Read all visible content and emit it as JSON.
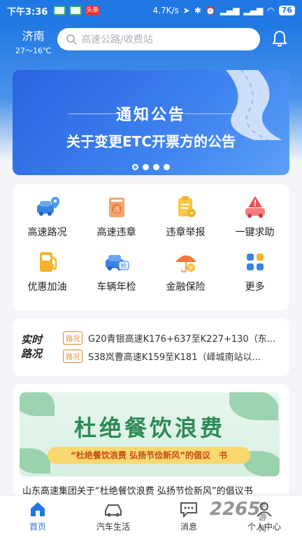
{
  "status_bar": {
    "time": "下午3:36",
    "app_badge": "头条",
    "net_speed": "4.7K/s",
    "battery": "76"
  },
  "header": {
    "city": "济南",
    "temp": "27～16℃",
    "search_placeholder": "高速公路/收费站"
  },
  "banner": {
    "title": "通知公告",
    "subtitle": "关于变更ETC开票方的公告",
    "dots": 4,
    "active_dot": 0
  },
  "services": [
    {
      "label": "高速路况",
      "icon": "car-location-icon",
      "color": "#3b82e6"
    },
    {
      "label": "高速违章",
      "icon": "violation-doc-icon",
      "color": "#f07a3a"
    },
    {
      "label": "违章举报",
      "icon": "report-doc-icon",
      "color": "#f3b32c"
    },
    {
      "label": "一键求助",
      "icon": "warning-car-icon",
      "color": "#ef4f4f"
    },
    {
      "label": "优惠加油",
      "icon": "fuel-pump-icon",
      "color": "#f3b32c"
    },
    {
      "label": "车辆年检",
      "icon": "car-inspection-icon",
      "color": "#3b82e6"
    },
    {
      "label": "金融保险",
      "icon": "umbrella-icon",
      "color": "#f07a3a"
    },
    {
      "label": "更多",
      "icon": "more-grid-icon",
      "color": "#3b82e6"
    }
  ],
  "traffic": {
    "title": "实时路况",
    "items": [
      {
        "tag": "路况",
        "text": "G20青银高速K176+637至K227+130（东..."
      },
      {
        "tag": "路况",
        "text": "S38岚曹高速K159至K181（峄城南站以..."
      }
    ]
  },
  "news": {
    "headline": "杜绝餐饮浪费",
    "pill": "“杜绝餐饮浪费 弘扬节俭新风”的倡议　书",
    "caption": "山东高速集团关于“杜绝餐饮浪费 弘扬节俭新风”的倡议书"
  },
  "tabs": [
    {
      "label": "首页",
      "icon": "home-icon",
      "active": true
    },
    {
      "label": "汽车生活",
      "icon": "car-icon",
      "active": false
    },
    {
      "label": "消息",
      "icon": "message-icon",
      "active": false
    },
    {
      "label": "个人中心",
      "icon": "user-icon",
      "active": false
    }
  ],
  "watermark": {
    "brand": "2265",
    "sub": "手游网"
  }
}
